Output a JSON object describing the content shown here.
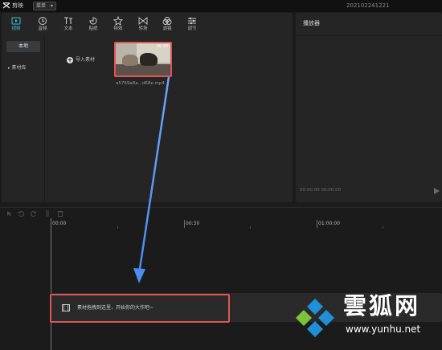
{
  "app": {
    "name": "剪映",
    "menu_label": "菜单",
    "project_name": "202102241221"
  },
  "toolbar": {
    "tabs": [
      {
        "label": "视频",
        "icon": "video-icon",
        "active": true
      },
      {
        "label": "音频",
        "icon": "audio-icon",
        "active": false
      },
      {
        "label": "文本",
        "icon": "text-icon",
        "active": false
      },
      {
        "label": "贴纸",
        "icon": "sticker-icon",
        "active": false
      },
      {
        "label": "特效",
        "icon": "effects-icon",
        "active": false
      },
      {
        "label": "转场",
        "icon": "transition-icon",
        "active": false
      },
      {
        "label": "滤镜",
        "icon": "filter-icon",
        "active": false
      },
      {
        "label": "调节",
        "icon": "adjust-icon",
        "active": false
      }
    ]
  },
  "sidebar": {
    "local_label": "本地",
    "library_label": "素材库"
  },
  "media": {
    "import_label": "导入素材",
    "clip": {
      "duration": "00:10",
      "filename": "a5769a8a...d68e.mp4"
    }
  },
  "player": {
    "title": "播放器",
    "time": "00:00:00  00:00:00"
  },
  "timeline": {
    "ticks": [
      "00:00",
      "00:30",
      "01:00:00"
    ],
    "drop_hint": "素材拖拽到这里，开始你的大作吧~"
  },
  "watermark": {
    "name": "雲狐网",
    "url": "www.yunhu.net"
  },
  "colors": {
    "accent": "#3fc3d6",
    "highlight_border": "#e05454",
    "arrow": "#5b9cff",
    "background": "#1b1b1c",
    "panel": "#252526"
  }
}
